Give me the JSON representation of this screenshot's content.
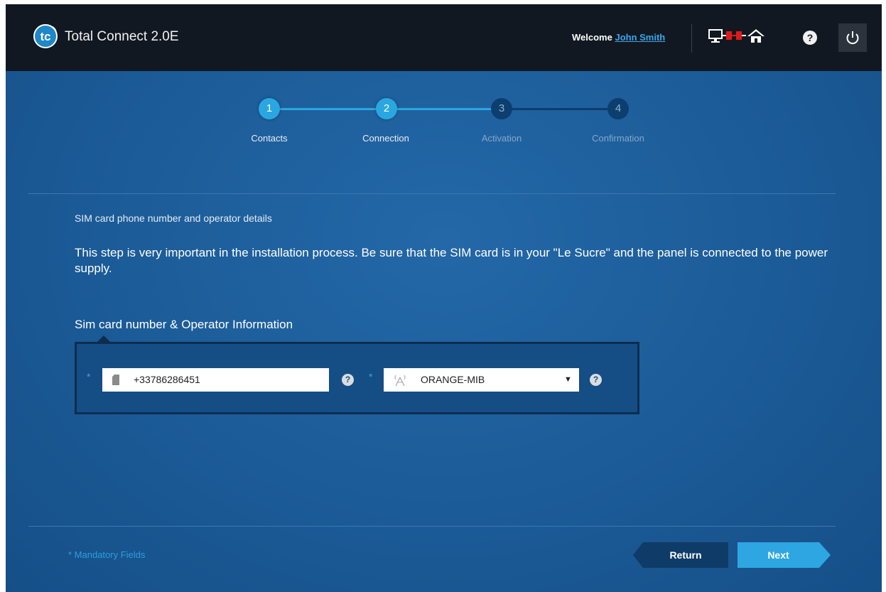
{
  "header": {
    "app_title": "Total Connect 2.0E",
    "logo_text": "tc",
    "welcome_prefix": "Welcome",
    "user_name": "John Smith",
    "help_glyph": "?",
    "power_icon": "power-icon"
  },
  "stepper": {
    "steps": [
      {
        "number": "1",
        "label": "Contacts",
        "state": "done"
      },
      {
        "number": "2",
        "label": "Connection",
        "state": "done"
      },
      {
        "number": "3",
        "label": "Activation",
        "state": "todo"
      },
      {
        "number": "4",
        "label": "Confirmation",
        "state": "todo"
      }
    ]
  },
  "main": {
    "section_subtitle": "SIM card phone number and operator details",
    "intro_text": "This step is very important in the installation process. Be sure that the SIM card is in your \"Le Sucre\" and the panel is connected to the power supply.",
    "group_title": "Sim card number & Operator Information",
    "phone_field": {
      "value": "+33786286451",
      "mandatory_mark": "*"
    },
    "operator_select": {
      "value": "ORANGE-MIB",
      "mandatory_mark": "*"
    },
    "info_glyph": "?"
  },
  "footer": {
    "mandatory_note": "* Mandatory Fields",
    "return_label": "Return",
    "next_label": "Next"
  },
  "colors": {
    "accent": "#2aa7e0",
    "background": "#1d5d99",
    "header": "#121821"
  }
}
